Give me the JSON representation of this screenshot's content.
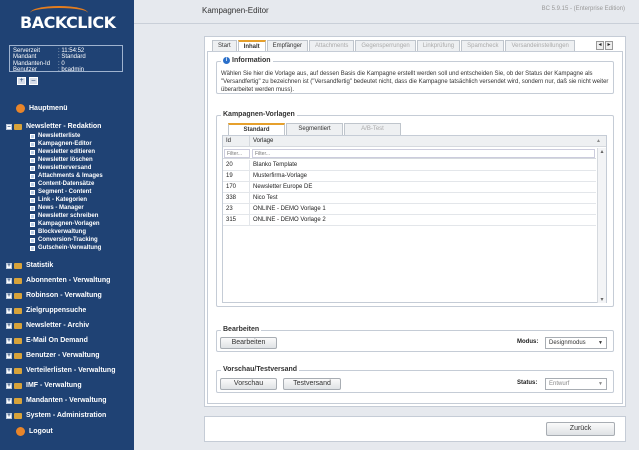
{
  "app": {
    "logo_text": "BACKCLICK",
    "header_title": "Kampagnen-Editor",
    "version": "BC 5.9.15 - (Enterprise Edition)"
  },
  "info": [
    {
      "k": "Serverzeit",
      "v": ": 11:54:52"
    },
    {
      "k": "Mandant",
      "v": ": Standard"
    },
    {
      "k": "Mandanten-Id",
      "v": ": 0"
    },
    {
      "k": "Benutzer",
      "v": ": bcadmin"
    }
  ],
  "toolbar": {
    "plus": "+",
    "minus": "–"
  },
  "sidebar": {
    "hauptmenue": "Hauptmenü",
    "section_open": "Newsletter - Redaktion",
    "sub": [
      "Newsletterliste",
      "Kampagnen-Editor",
      "Newsletter editieren",
      "Newsletter löschen",
      "Newsletterversand",
      "Attachments & Images",
      "Content-Datensätze",
      "Segment - Content",
      "Link - Kategorien",
      "News - Manager",
      "Newsletter schreiben",
      "Kampagnen-Vorlagen",
      "Blockverwaltung",
      "Conversion-Tracking",
      "Gutschein-Verwaltung"
    ],
    "sections": [
      "Statistik",
      "Abonnenten - Verwaltung",
      "Robinson - Verwaltung",
      "Zielgruppensuche",
      "Newsletter - Archiv",
      "E-Mail On Demand",
      "Benutzer - Verwaltung",
      "Verteilerlisten - Verwaltung",
      "IMF - Verwaltung",
      "Mandanten - Verwaltung",
      "System - Administration"
    ],
    "logout": "Logout"
  },
  "tabs": [
    "Start",
    "Inhalt",
    "Empfänger",
    "Attachments",
    "Gegensperrungen",
    "Linkprüfung",
    "Spamcheck",
    "Versandeinstellungen"
  ],
  "tabs_nav": {
    "prev": "◂",
    "next": "▸"
  },
  "information": {
    "legend": "Information",
    "text": "Wählen Sie hier die Vorlage aus, auf dessen Basis die Kampagne erstellt werden soll und entscheiden Sie, ob der Status der Kampagne als \"Versandfertig\" zu bezeichnen ist (\"Versandfertig\" bedeutet nicht, dass die Kampagne tatsächlich versendet wird, sondern nur, daß sie nicht weiter überarbeitet werden muss)."
  },
  "vorlagen": {
    "legend": "Kampagnen-Vorlagen",
    "subtabs": [
      "Standard",
      "Segmentiert",
      "A/B-Test"
    ],
    "col_id": "Id",
    "col_vorlage": "Vorlage",
    "filter_placeholder": "Filter...",
    "sort_icon": "▲",
    "rows": [
      {
        "id": "20",
        "name": "Blanko Template"
      },
      {
        "id": "19",
        "name": "Musterfirma-Vorlage"
      },
      {
        "id": "170",
        "name": "Newsletter Europe DE"
      },
      {
        "id": "338",
        "name": "Nico Test"
      },
      {
        "id": "23",
        "name": "ONLINE - DEMO Vorlage 1"
      },
      {
        "id": "315",
        "name": "ONLINE - DEMO Vorlage 2"
      }
    ],
    "scroll_up": "▴",
    "scroll_down": "▾"
  },
  "bearbeiten": {
    "legend": "Bearbeiten",
    "button": "Bearbeiten",
    "modus_label": "Modus:",
    "modus_value": "Designmodus",
    "arrow": "▼"
  },
  "vorschau": {
    "legend": "Vorschau/Testversand",
    "vorschau": "Vorschau",
    "testversand": "Testversand",
    "status_label": "Status:",
    "status_value": "Entwurf",
    "arrow": "▼"
  },
  "footer": {
    "back": "Zurück"
  }
}
